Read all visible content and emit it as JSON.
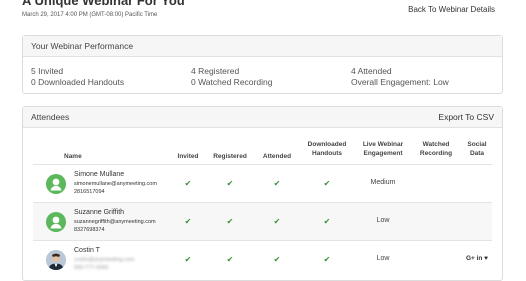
{
  "header": {
    "title": "A Unique Webinar For You",
    "subtitle": "March 29, 2017 4:00 PM   (GMT-08:00) Pacific Time",
    "back_link": "Back To Webinar Details"
  },
  "performance": {
    "title": "Your Webinar Performance",
    "stats": {
      "invited": "5 Invited",
      "downloaded": "0 Downloaded Handouts",
      "registered": "4 Registered",
      "watched": "0 Watched Recording",
      "attended": "4 Attended",
      "engagement": "Overall Engagement: Low"
    }
  },
  "attendees": {
    "title": "Attendees",
    "export_label": "Export To CSV",
    "columns": {
      "name": "Name",
      "invited": "Invited",
      "registered": "Registered",
      "attended": "Attended",
      "handouts": "Downloaded\nHandouts",
      "engagement": "Live Webinar\nEngagement",
      "watched": "Watched\nRecording",
      "social": "Social\nData"
    },
    "check_glyph": "✔",
    "rows": [
      {
        "name": "Simone Mullane",
        "email": "simonemullane@anymeeting.com",
        "phone": "2816517094",
        "engagement": "Medium",
        "social": ""
      },
      {
        "name": "Suzanne Griffith",
        "email": "suzannegriffith@anymeeting.com",
        "phone": "8327698374",
        "engagement": "Low",
        "social": ""
      },
      {
        "name": "Costin T",
        "email": "costin@anymeeting.com",
        "phone": "000-777-0000",
        "engagement": "Low",
        "social": "G+ in ♥"
      }
    ]
  }
}
